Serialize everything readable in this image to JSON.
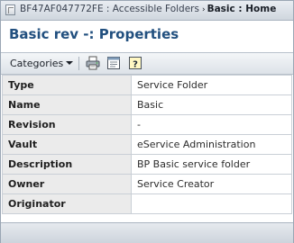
{
  "breadcrumb": {
    "path_label": "BF47AF047772FE : Accessible Folders",
    "current_label": "Basic : Home"
  },
  "page": {
    "title": "Basic rev -: Properties"
  },
  "toolbar": {
    "categories_label": "Categories",
    "buttons": [
      {
        "icon": "print-icon"
      },
      {
        "icon": "export-icon"
      },
      {
        "icon": "help-icon"
      }
    ]
  },
  "properties": [
    {
      "key": "Type",
      "value": "Service Folder"
    },
    {
      "key": "Name",
      "value": "Basic"
    },
    {
      "key": "Revision",
      "value": "-"
    },
    {
      "key": "Vault",
      "value": "eService Administration"
    },
    {
      "key": "Description",
      "value": "BP Basic service folder"
    },
    {
      "key": "Owner",
      "value": "Service Creator"
    },
    {
      "key": "Originator",
      "value": ""
    }
  ]
}
